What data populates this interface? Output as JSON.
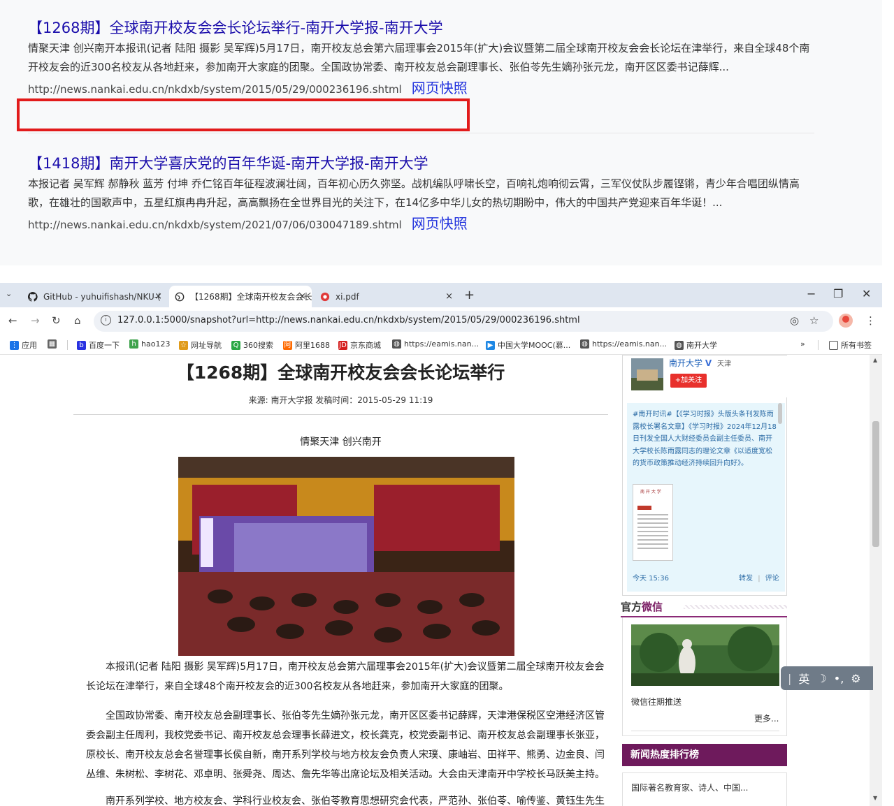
{
  "results": [
    {
      "title": "【1268期】全球南开校友会会长论坛举行-南开大学报-南开大学",
      "snippet": "情聚天津 创兴南开本报讯(记者 陆阳 摄影 吴军辉)5月17日，南开校友总会第六届理事会2015年(扩大)会议暨第二届全球南开校友会会长论坛在津举行，来自全球48个南开校友会的近300名校友从各地赶来，参加南开大家庭的团聚。全国政协常委、南开校友总会副理事长、张伯苓先生嫡孙张元龙，南开区区委书记薛辉...",
      "url": "http://news.nankai.edu.cn/nkdxb/system/2015/05/29/000236196.shtml",
      "snapshot_label": "网页快照"
    },
    {
      "title": "【1418期】南开大学喜庆党的百年华诞-南开大学报-南开大学",
      "snippet": "本报记者 吴军辉 郝静秋 蓝芳 付坤 乔仁铭百年征程波澜壮阔，百年初心历久弥坚。战机编队呼啸长空，百响礼炮响彻云霄，三军仪仗队步履铿锵，青少年合唱团纵情高歌，在雄壮的国歌声中，五星红旗冉冉升起，高高飘扬在全世界目光的关注下，在14亿多中华儿女的热切期盼中，伟大的中国共产党迎来百年华诞！...",
      "url": "http://news.nankai.edu.cn/nkdxb/system/2021/07/06/030047189.shtml",
      "snapshot_label": "网页快照"
    }
  ],
  "browser": {
    "tabs": [
      {
        "title": "GitHub - yuhuifishash/NKU-(",
        "icon": "github-icon",
        "active": false
      },
      {
        "title": "【1268期】全球南开校友会会长",
        "icon": "globe-icon",
        "active": true
      },
      {
        "title": "xi.pdf",
        "icon": "pdf-icon",
        "active": false
      }
    ],
    "tab_close": "×",
    "new_tab": "+",
    "window_controls": {
      "minimize": "−",
      "restore": "❐",
      "close": "✕"
    },
    "address": "127.0.0.1:5000/snapshot?url=http://news.nankai.edu.cn/nkdxb/system/2015/05/29/000236196.shtml",
    "bookmarks": [
      {
        "label": "应用",
        "color": "#1a73e8"
      },
      {
        "label": "百度一下",
        "color": "#2932e1"
      },
      {
        "label": "hao123",
        "color": "#3fa34d"
      },
      {
        "label": "网址导航",
        "color": "#e09b1a"
      },
      {
        "label": "360搜索",
        "color": "#2aa845"
      },
      {
        "label": "阿里1688",
        "color": "#ff6a00"
      },
      {
        "label": "京东商城",
        "color": "#d51e1e"
      },
      {
        "label": "https://eamis.nan...",
        "color": "#555555"
      },
      {
        "label": "中国大学MOOC(慕...",
        "color": "#1e88e5"
      },
      {
        "label": "https://eamis.nan...",
        "color": "#555555"
      },
      {
        "label": "南开大学",
        "color": "#555555"
      }
    ],
    "bookmarks_overflow": "»",
    "all_bookmarks": "所有书签"
  },
  "article": {
    "title": "【1268期】全球南开校友会会长论坛举行",
    "meta": "来源:  南开大学报  发稿时间：2015-05-29 11:19",
    "subtitle": "情聚天津  创兴南开",
    "paragraphs": [
      "本报讯(记者 陆阳 摄影 吴军辉)5月17日，南开校友总会第六届理事会2015年(扩大)会议暨第二届全球南开校友会会长论坛在津举行，来自全球48个南开校友会的近300名校友从各地赶来，参加南开大家庭的团聚。",
      "全国政协常委、南开校友总会副理事长、张伯苓先生嫡孙张元龙，南开区区委书记薛辉，天津港保税区空港经济区管委会副主任周利，我校党委书记、南开校友总会理事长薛进文，校长龚克，校党委副书记、南开校友总会副理事长张亚，原校长、南开校友总会名誉理事长侯自新，南开系列学校与地方校友会负责人宋璞、康岫岩、田祥平、熊勇、边金良、闫丛维、朱树松、李树花、邓卓明、张舜尧、周达、詹先华等出席论坛及相关活动。大会由天津南开中学校长马跃美主持。",
      "南开系列学校、地方校友会、学科行业校友会、张伯苓教育思想研究会代表，严范孙、张伯苓、喻传鉴、黄钰生先生"
    ]
  },
  "sidebar": {
    "weibo": {
      "name": "南开大学",
      "verified": "V",
      "location": "天津",
      "follow": "+加关注",
      "post": "#南开时讯#【《学习时报》头版头条刊发陈雨露校长署名文章】《学习时报》2024年12月18日刊发全国人大财经委员会副主任委员、南开大学校长陈雨露同志的理论文章《以适度宽松的货币政策推动经济持续回升向好》。",
      "time": "今天 15:36",
      "repost": "转发",
      "divider": "|",
      "comment": "评论"
    },
    "wechat": {
      "title_a": "官方",
      "title_b": "微信",
      "caption": "微信往期推送",
      "more": "更多..."
    },
    "hot": {
      "title": "新闻热度排行榜",
      "items": [
        "国际著名教育家、诗人、中国..."
      ]
    }
  },
  "ime": {
    "lang": "英",
    "moon": "☽",
    "dot": "•,",
    "gear": "⚙"
  }
}
